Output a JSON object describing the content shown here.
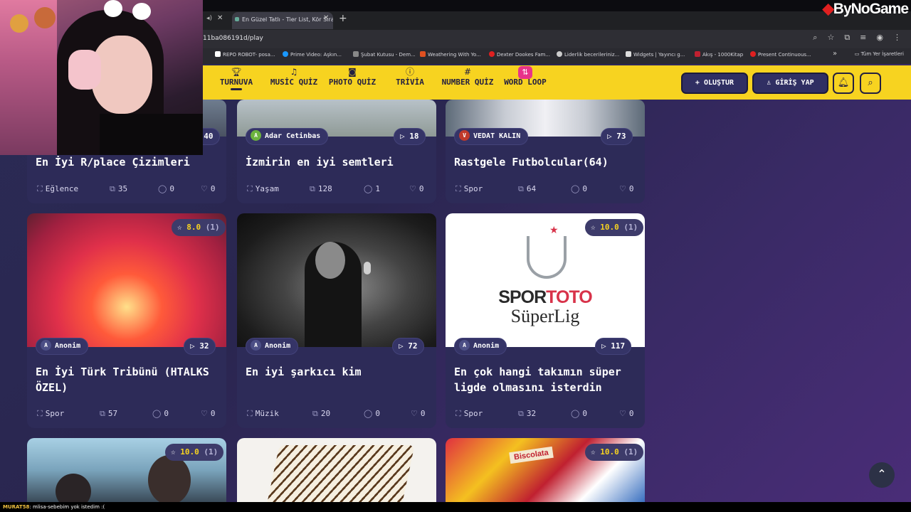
{
  "brand": {
    "logo_text": "ByNoGame"
  },
  "browser": {
    "tab_title": "En Güzel Tatlı - Tier List, Kör Sıralama",
    "url": "11ba086191d/play",
    "bookmarks": [
      "REPO ROBOT- posa...",
      "Prime Video: Aşkın...",
      "Şubat Kutusu - Dem...",
      "Weathering With Yo...",
      "Dexter Dookes Fam...",
      "Liderlik becerileriniz...",
      "Widgets | Yayıncı g...",
      "Akış - 1000Kitap",
      "Present Continuous..."
    ],
    "all_bookmarks": "Tüm Yer İşaretleri"
  },
  "nav": {
    "items": [
      {
        "label": "TURNUVA",
        "icon": "trophy-icon"
      },
      {
        "label": "MUSİC QUİZ",
        "icon": "music-icon"
      },
      {
        "label": "PHOTO QUİZ",
        "icon": "camera-icon"
      },
      {
        "label": "TRİVİA",
        "icon": "question-icon"
      },
      {
        "label": "NUMBER QUİZ",
        "icon": "hash-icon"
      },
      {
        "label": "WORD LOOP",
        "icon": "sort-icon"
      }
    ],
    "create_label": "OLUŞTUR",
    "login_label": "GİRİŞ YAP"
  },
  "cards": [
    {
      "title": "En İyi R/place Çizimleri",
      "author": "",
      "author_initial": "",
      "plays": "40",
      "rating": "",
      "count": "",
      "category": "Eğlence",
      "items": "35",
      "comments": "0",
      "likes": "0"
    },
    {
      "title": "İzmirin en iyi semtleri",
      "author": "Adar Cetinbas",
      "author_initial": "A",
      "plays": "18",
      "rating": "",
      "count": "",
      "category": "Yaşam",
      "items": "128",
      "comments": "1",
      "likes": "0"
    },
    {
      "title": "Rastgele Futbolcular(64)",
      "author": "VEDAT KALIN",
      "author_initial": "V",
      "plays": "73",
      "rating": "",
      "count": "",
      "category": "Spor",
      "items": "64",
      "comments": "0",
      "likes": "0"
    },
    {
      "title": "En İyi Türk Tribünü (HTALKS ÖZEL)",
      "author": "Anonim",
      "author_initial": "A",
      "plays": "32",
      "rating": "8.0",
      "count": "(1)",
      "category": "Spor",
      "items": "57",
      "comments": "0",
      "likes": "0"
    },
    {
      "title": "En iyi şarkıcı kim",
      "author": "Anonim",
      "author_initial": "A",
      "plays": "72",
      "rating": "",
      "count": "",
      "category": "Müzik",
      "items": "20",
      "comments": "0",
      "likes": "0"
    },
    {
      "title": "En çok hangi takımın süper ligde olmasını isterdin",
      "author": "Anonim",
      "author_initial": "A",
      "plays": "117",
      "rating": "10.0",
      "count": "(1)",
      "category": "Spor",
      "items": "32",
      "comments": "0",
      "likes": "0"
    },
    {
      "title": "",
      "author": "",
      "author_initial": "",
      "plays": "",
      "rating": "10.0",
      "count": "(1)",
      "category": "",
      "items": "",
      "comments": "",
      "likes": ""
    },
    {
      "title": "",
      "author": "",
      "author_initial": "",
      "plays": "",
      "rating": "",
      "count": "",
      "category": "",
      "items": "",
      "comments": "",
      "likes": ""
    },
    {
      "title": "",
      "author": "",
      "author_initial": "",
      "plays": "",
      "rating": "10.0",
      "count": "(1)",
      "category": "",
      "items": "",
      "comments": "",
      "likes": ""
    }
  ],
  "image_texts": {
    "sportoto": "SPORTOTO",
    "superlig": "SüperLig",
    "biscolata": "Biscolata"
  },
  "chat": {
    "user": "MURAT58",
    "message": ": mlisa-sebebim yok istedim :("
  },
  "colors": {
    "accent": "#f7d320",
    "card": "#2d2b58",
    "wordloop": "#e8338a"
  }
}
